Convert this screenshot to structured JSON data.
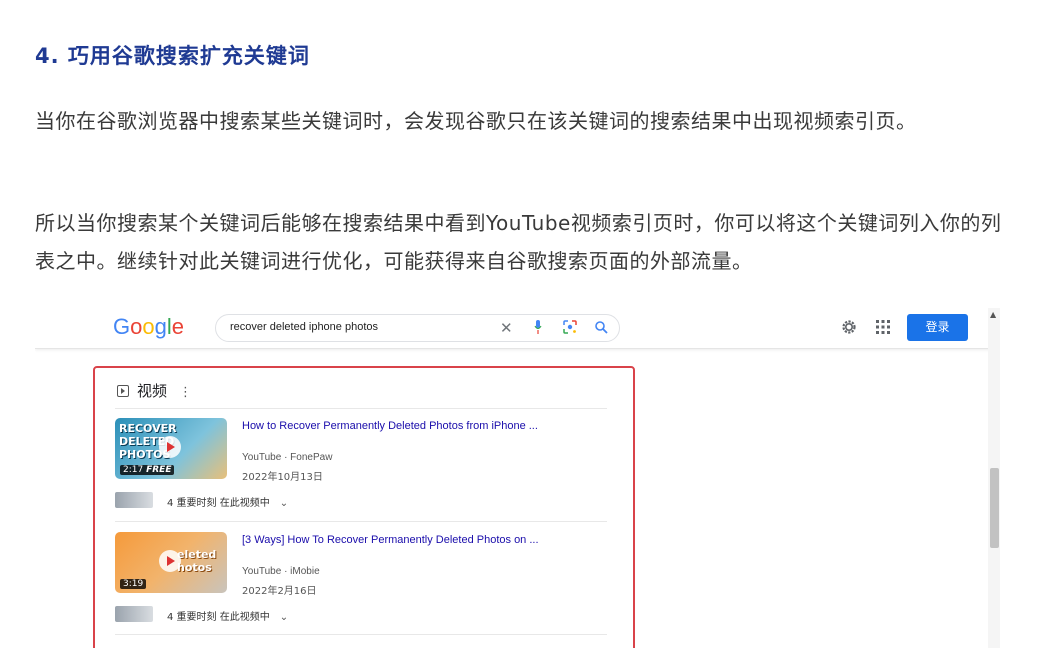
{
  "article": {
    "heading": "4. 巧用谷歌搜索扩充关键词",
    "paragraph1": "当你在谷歌浏览器中搜索某些关键词时，会发现谷歌只在该关键词的搜索结果中出现视频索引页。",
    "paragraph2": "所以当你搜索某个关键词后能够在搜索结果中看到YouTube视频索引页时，你可以将这个关键词列入你的列表之中。继续针对此关键词进行优化，可能获得来自谷歌搜索页面的外部流量。"
  },
  "google": {
    "logo": [
      "G",
      "o",
      "o",
      "g",
      "l",
      "e"
    ],
    "logo_colors": [
      "#4285F4",
      "#EA4335",
      "#FBBC05",
      "#4285F4",
      "#34A853",
      "#EA4335"
    ],
    "search_query": "recover deleted iphone photos",
    "clear_symbol": "✕",
    "login_label": "登录",
    "scroll_up_symbol": "▲"
  },
  "videos_section": {
    "header": "视频",
    "menu_symbol": "⋮",
    "items": [
      {
        "title": "How to Recover Permanently Deleted Photos from iPhone ...",
        "source": "YouTube · FonePaw",
        "date": "2022年10月13日",
        "thumb_text": "RECOVER\nDELETED\nPHOTOS",
        "duration": "2:17",
        "thumb_badge": "FREE",
        "key_moments": "4 重要时刻 在此视频中",
        "chevron": "⌄"
      },
      {
        "title": "[3 Ways] How To Recover Permanently Deleted Photos on ...",
        "source": "YouTube · iMobie",
        "date": "2022年2月16日",
        "thumb_text": "eleted\nhotos",
        "duration": "3:19",
        "key_moments": "4 重要时刻 在此视频中",
        "chevron": "⌄"
      }
    ]
  }
}
